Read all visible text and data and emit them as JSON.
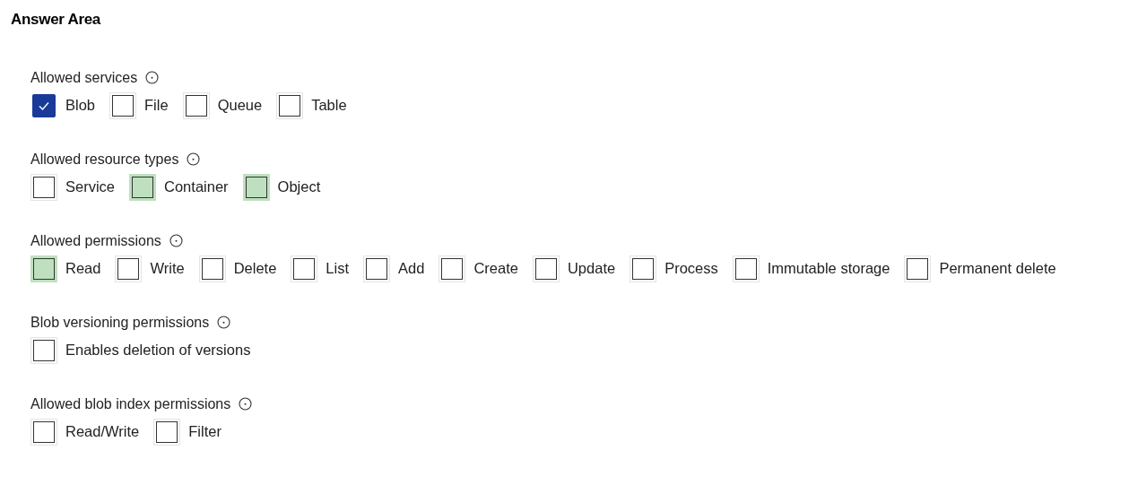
{
  "title": "Answer Area",
  "sections": [
    {
      "label": "Allowed services",
      "options": [
        {
          "label": "Blob",
          "checked": true,
          "highlighted": false
        },
        {
          "label": "File",
          "checked": false,
          "highlighted": false
        },
        {
          "label": "Queue",
          "checked": false,
          "highlighted": false
        },
        {
          "label": "Table",
          "checked": false,
          "highlighted": false
        }
      ]
    },
    {
      "label": "Allowed resource types",
      "options": [
        {
          "label": "Service",
          "checked": false,
          "highlighted": false
        },
        {
          "label": "Container",
          "checked": false,
          "highlighted": true
        },
        {
          "label": "Object",
          "checked": false,
          "highlighted": true
        }
      ]
    },
    {
      "label": "Allowed permissions",
      "options": [
        {
          "label": "Read",
          "checked": false,
          "highlighted": true
        },
        {
          "label": "Write",
          "checked": false,
          "highlighted": false
        },
        {
          "label": "Delete",
          "checked": false,
          "highlighted": false
        },
        {
          "label": "List",
          "checked": false,
          "highlighted": false
        },
        {
          "label": "Add",
          "checked": false,
          "highlighted": false
        },
        {
          "label": "Create",
          "checked": false,
          "highlighted": false
        },
        {
          "label": "Update",
          "checked": false,
          "highlighted": false
        },
        {
          "label": "Process",
          "checked": false,
          "highlighted": false
        },
        {
          "label": "Immutable storage",
          "checked": false,
          "highlighted": false
        },
        {
          "label": "Permanent delete",
          "checked": false,
          "highlighted": false
        }
      ]
    },
    {
      "label": "Blob versioning permissions",
      "options": [
        {
          "label": "Enables deletion of versions",
          "checked": false,
          "highlighted": false
        }
      ]
    },
    {
      "label": "Allowed blob index permissions",
      "options": [
        {
          "label": "Read/Write",
          "checked": false,
          "highlighted": false
        },
        {
          "label": "Filter",
          "checked": false,
          "highlighted": false
        }
      ]
    }
  ]
}
